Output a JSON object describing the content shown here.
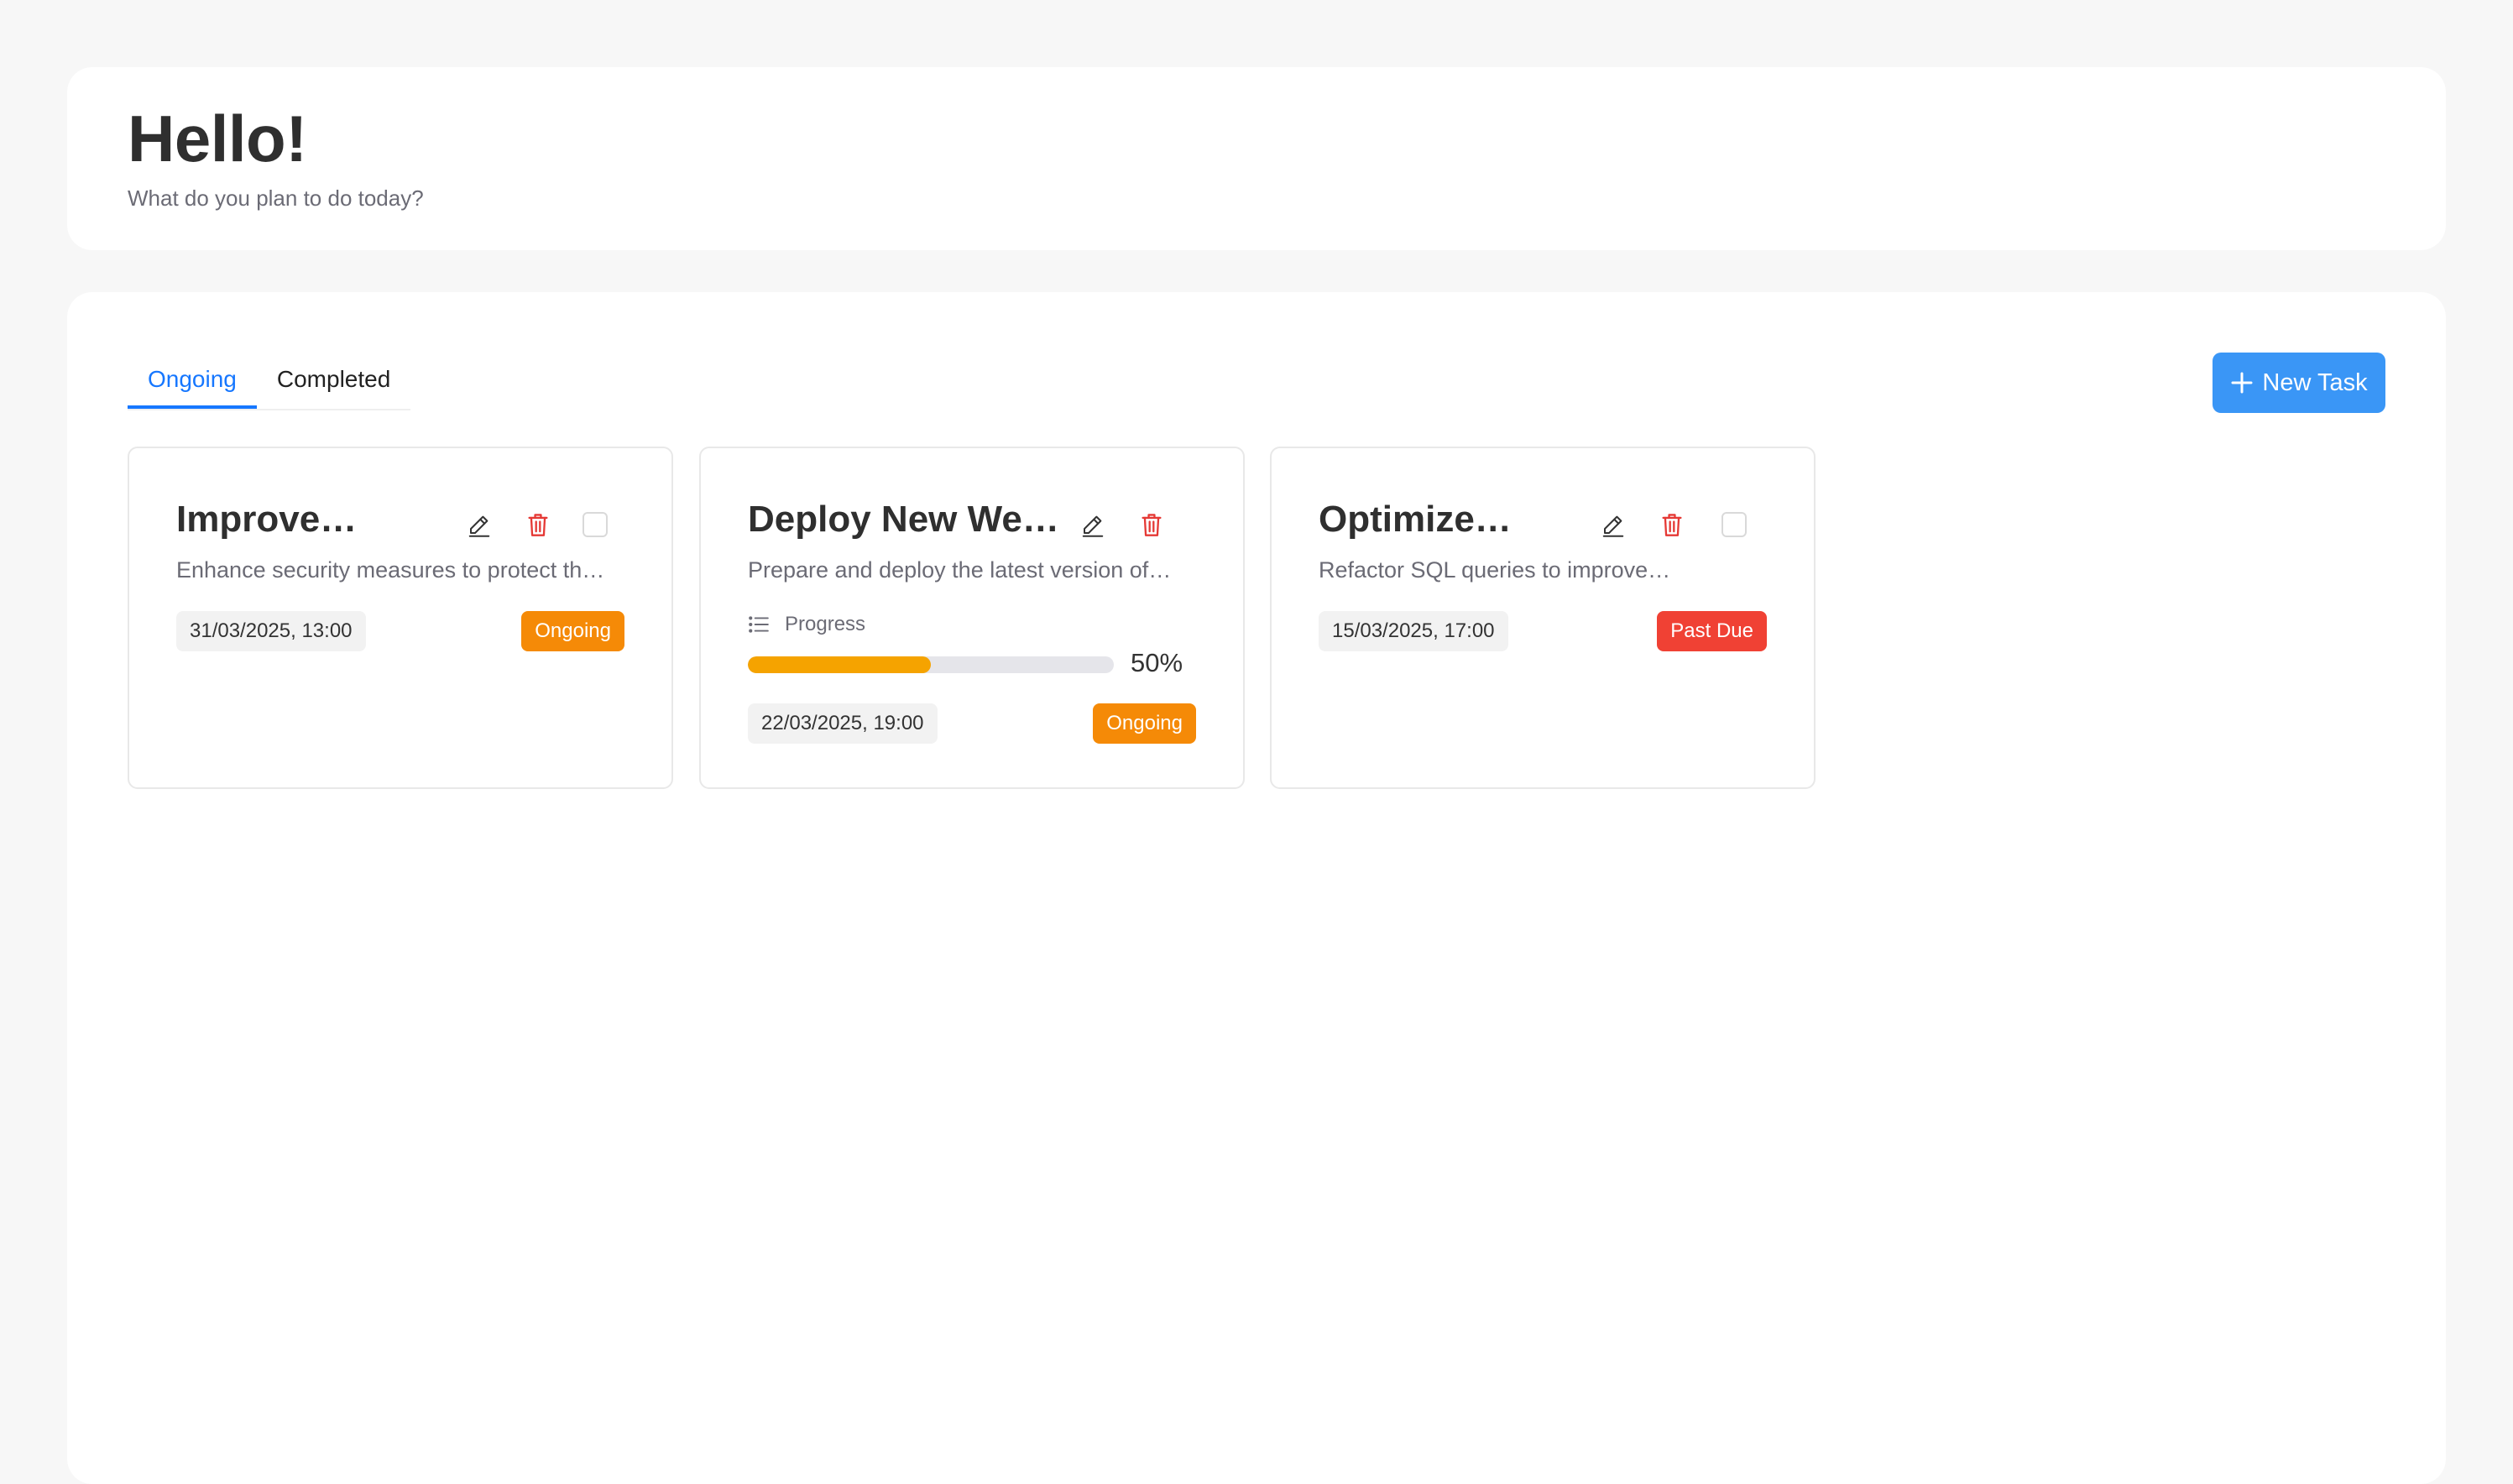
{
  "header": {
    "greeting": "Hello!",
    "subtitle": "What do you plan to do today?"
  },
  "tabs": [
    {
      "label": "Ongoing",
      "active": true
    },
    {
      "label": "Completed",
      "active": false
    }
  ],
  "new_task_button": {
    "label": "New Task",
    "icon": "plus-icon"
  },
  "colors": {
    "accent": "#1677ff",
    "button": "#3a96f6",
    "ongoing": "#f58a07",
    "past_due": "#f04134",
    "progress_fill": "#f5a300",
    "delete_icon": "#e53935"
  },
  "tasks": [
    {
      "title": "Improve…",
      "description": "Enhance security measures to protect th…",
      "due": "31/03/2025, 13:00",
      "status": "Ongoing",
      "status_color": "#f58a07",
      "has_checkbox": true,
      "checked": false
    },
    {
      "title": "Deploy New We…",
      "description": "Prepare and deploy the latest version of…",
      "progress_label": "Progress",
      "progress": 50,
      "progress_text": "50%",
      "due": "22/03/2025, 19:00",
      "status": "Ongoing",
      "status_color": "#f58a07",
      "has_checkbox": false
    },
    {
      "title": "Optimize…",
      "description": "Refactor SQL queries to improve…",
      "due": "15/03/2025, 17:00",
      "status": "Past Due",
      "status_color": "#f04134",
      "has_checkbox": true,
      "checked": false
    }
  ]
}
